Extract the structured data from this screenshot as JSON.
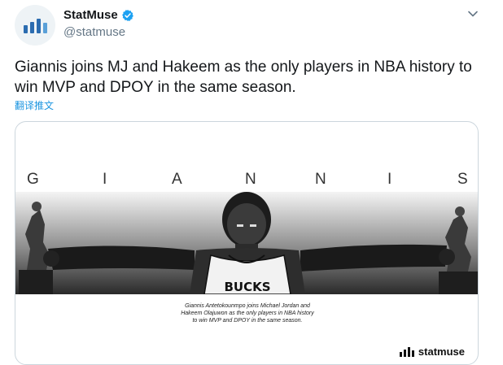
{
  "tweet": {
    "display_name": "StatMuse",
    "handle": "@statmuse",
    "text": "Giannis joins MJ and Hakeem as the only players in NBA history to win MVP and DPOY in the same season.",
    "translate_label": "翻译推文",
    "verified_icon": "verified-badge-icon",
    "menu_icon": "chevron-down-icon"
  },
  "card": {
    "headline_letters": [
      "G",
      "I",
      "A",
      "N",
      "N",
      "I",
      "S"
    ],
    "jersey_text": "BUCKS",
    "caption_lines": [
      "Giannis Antetokounmpo joins Michael Jordan and",
      "Hakeem Olajuwon as the only players in NBA history",
      "to win MVP and DPOY in the same season."
    ],
    "logo_text": "statmuse"
  },
  "colors": {
    "brand_blue": "#1b95e0",
    "avatar_blue": "#2b6cb0",
    "text": "#14171a",
    "muted": "#657786"
  }
}
